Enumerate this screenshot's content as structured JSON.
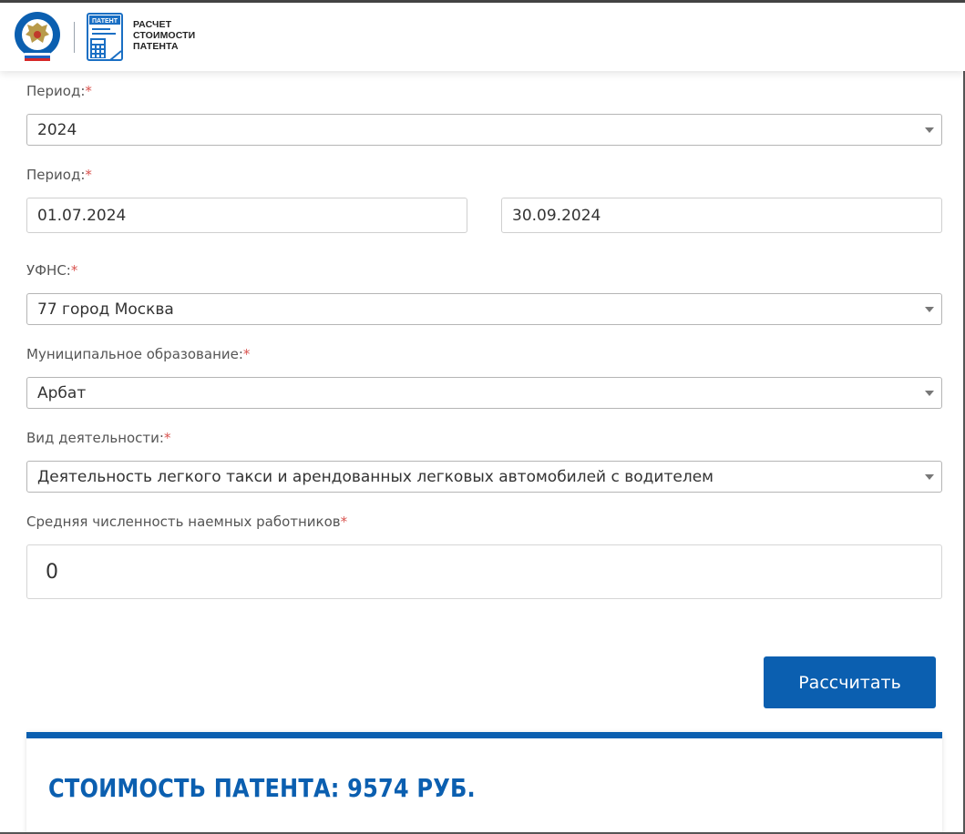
{
  "header": {
    "logo_lines": [
      "РАСЧЕТ",
      "СТОИМОСТИ",
      "ПАТЕНТА"
    ],
    "patent_icon_label": "ПАТЕНТ"
  },
  "form": {
    "required_mark": "*",
    "period_year": {
      "label": "Период:",
      "value": "2024"
    },
    "period_dates": {
      "label": "Период:",
      "from": "01.07.2024",
      "to": "30.09.2024"
    },
    "ufns": {
      "label": "УФНС:",
      "value": "77 город Москва"
    },
    "municipality": {
      "label": "Муниципальное образование:",
      "value": "Арбат"
    },
    "activity": {
      "label": "Вид деятельности:",
      "value": "Деятельность легкого такси и арендованных легковых автомобилей с водителем"
    },
    "employees": {
      "label": "Средняя численность наемных работников",
      "value": "0"
    },
    "submit_label": "Рассчитать"
  },
  "result": {
    "title": "СТОИМОСТЬ ПАТЕНТА: 9574 РУБ."
  },
  "colors": {
    "accent": "#0b5fb0",
    "required": "#d9534f"
  },
  "icons": [
    "fns-emblem-icon",
    "patent-calculator-icon",
    "dropdown-arrow-icon"
  ]
}
